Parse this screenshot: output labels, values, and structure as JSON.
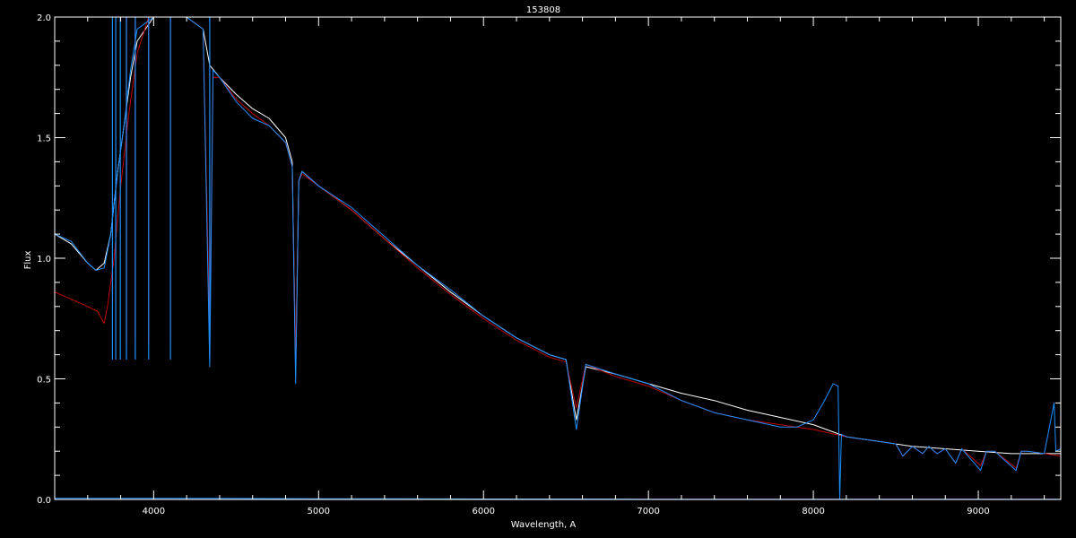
{
  "chart_data": {
    "type": "line",
    "title": "153808",
    "xlabel": "Wavelength, A",
    "ylabel": "Flux",
    "xlim": [
      3400,
      9500
    ],
    "ylim": [
      0.0,
      2.0
    ],
    "x_ticks": [
      4000,
      5000,
      6000,
      7000,
      8000,
      9000
    ],
    "x_tick_labels": [
      "4000",
      "5000",
      "6000",
      "7000",
      "8000",
      "9000"
    ],
    "y_ticks": [
      0.0,
      0.5,
      1.0,
      1.5,
      2.0
    ],
    "y_tick_labels": [
      "0.0",
      "0.5",
      "1.0",
      "1.5",
      "2.0"
    ],
    "background": "#000000",
    "series": [
      {
        "color": "#ffffff",
        "points": [
          [
            3400,
            1.1
          ],
          [
            3500,
            1.06
          ],
          [
            3600,
            0.98
          ],
          [
            3650,
            0.95
          ],
          [
            3700,
            0.98
          ],
          [
            3740,
            1.1
          ],
          [
            3780,
            1.35
          ],
          [
            3820,
            1.55
          ],
          [
            3860,
            1.75
          ],
          [
            3900,
            1.9
          ],
          [
            4000,
            2.2
          ],
          [
            4100,
            2.2
          ],
          [
            4200,
            2.1
          ],
          [
            4300,
            1.95
          ],
          [
            4340,
            1.8
          ],
          [
            4400,
            1.75
          ],
          [
            4500,
            1.68
          ],
          [
            4600,
            1.62
          ],
          [
            4700,
            1.58
          ],
          [
            4800,
            1.5
          ],
          [
            4840,
            1.4
          ],
          [
            4861,
            0.55
          ],
          [
            4880,
            1.32
          ],
          [
            4900,
            1.36
          ],
          [
            5000,
            1.3
          ],
          [
            5200,
            1.2
          ],
          [
            5400,
            1.08
          ],
          [
            5600,
            0.97
          ],
          [
            5800,
            0.86
          ],
          [
            6000,
            0.76
          ],
          [
            6200,
            0.67
          ],
          [
            6400,
            0.6
          ],
          [
            6500,
            0.58
          ],
          [
            6563,
            0.33
          ],
          [
            6620,
            0.55
          ],
          [
            6800,
            0.52
          ],
          [
            7000,
            0.48
          ],
          [
            7200,
            0.44
          ],
          [
            7400,
            0.41
          ],
          [
            7600,
            0.37
          ],
          [
            7800,
            0.34
          ],
          [
            8000,
            0.31
          ],
          [
            8200,
            0.26
          ],
          [
            8400,
            0.24
          ],
          [
            8600,
            0.22
          ],
          [
            8800,
            0.21
          ],
          [
            9000,
            0.2
          ],
          [
            9200,
            0.19
          ],
          [
            9400,
            0.19
          ],
          [
            9500,
            0.19
          ]
        ]
      },
      {
        "color": "#c00000",
        "points": [
          [
            3400,
            0.86
          ],
          [
            3500,
            0.83
          ],
          [
            3600,
            0.8
          ],
          [
            3660,
            0.78
          ],
          [
            3700,
            0.73
          ],
          [
            3720,
            0.8
          ],
          [
            3760,
            1.0
          ],
          [
            3800,
            1.3
          ],
          [
            3850,
            1.6
          ],
          [
            3900,
            1.85
          ],
          [
            3970,
            2.2
          ],
          [
            4100,
            2.2
          ],
          [
            4200,
            2.15
          ],
          [
            4300,
            1.95
          ],
          [
            4340,
            0.7
          ],
          [
            4360,
            1.75
          ],
          [
            4400,
            1.75
          ],
          [
            4500,
            1.66
          ],
          [
            4600,
            1.6
          ],
          [
            4700,
            1.55
          ],
          [
            4800,
            1.48
          ],
          [
            4840,
            1.38
          ],
          [
            4861,
            0.6
          ],
          [
            4880,
            1.32
          ],
          [
            4900,
            1.35
          ],
          [
            5000,
            1.3
          ],
          [
            5200,
            1.2
          ],
          [
            5400,
            1.08
          ],
          [
            5600,
            0.96
          ],
          [
            5800,
            0.85
          ],
          [
            6000,
            0.75
          ],
          [
            6200,
            0.66
          ],
          [
            6400,
            0.59
          ],
          [
            6500,
            0.57
          ],
          [
            6563,
            0.38
          ],
          [
            6620,
            0.56
          ],
          [
            6800,
            0.51
          ],
          [
            7000,
            0.47
          ],
          [
            7200,
            0.41
          ],
          [
            7400,
            0.36
          ],
          [
            7600,
            0.33
          ],
          [
            7800,
            0.31
          ],
          [
            8000,
            0.29
          ],
          [
            8200,
            0.26
          ],
          [
            8400,
            0.24
          ],
          [
            8500,
            0.23
          ],
          [
            8542,
            0.18
          ],
          [
            8600,
            0.22
          ],
          [
            8662,
            0.19
          ],
          [
            8700,
            0.22
          ],
          [
            8750,
            0.19
          ],
          [
            8800,
            0.21
          ],
          [
            8863,
            0.15
          ],
          [
            8900,
            0.21
          ],
          [
            9014,
            0.14
          ],
          [
            9050,
            0.2
          ],
          [
            9100,
            0.2
          ],
          [
            9229,
            0.13
          ],
          [
            9260,
            0.2
          ],
          [
            9300,
            0.2
          ],
          [
            9500,
            0.18
          ]
        ]
      },
      {
        "color": "#1e90ff",
        "points": [
          [
            3400,
            1.1
          ],
          [
            3500,
            1.07
          ],
          [
            3600,
            0.98
          ],
          [
            3650,
            0.95
          ],
          [
            3700,
            0.96
          ],
          [
            3740,
            1.1
          ],
          [
            3780,
            1.35
          ],
          [
            3820,
            1.55
          ],
          [
            3860,
            1.78
          ],
          [
            3900,
            1.95
          ],
          [
            4000,
            2.2
          ],
          [
            4100,
            2.2
          ],
          [
            4200,
            2.1
          ],
          [
            4300,
            1.95
          ],
          [
            4340,
            0.55
          ],
          [
            4360,
            1.78
          ],
          [
            4400,
            1.75
          ],
          [
            4500,
            1.65
          ],
          [
            4600,
            1.58
          ],
          [
            4700,
            1.55
          ],
          [
            4800,
            1.48
          ],
          [
            4840,
            1.38
          ],
          [
            4861,
            0.48
          ],
          [
            4880,
            1.32
          ],
          [
            4900,
            1.36
          ],
          [
            5000,
            1.3
          ],
          [
            5200,
            1.21
          ],
          [
            5400,
            1.09
          ],
          [
            5600,
            0.97
          ],
          [
            5800,
            0.87
          ],
          [
            6000,
            0.76
          ],
          [
            6200,
            0.67
          ],
          [
            6400,
            0.6
          ],
          [
            6500,
            0.58
          ],
          [
            6563,
            0.29
          ],
          [
            6620,
            0.56
          ],
          [
            6800,
            0.52
          ],
          [
            7000,
            0.48
          ],
          [
            7200,
            0.41
          ],
          [
            7400,
            0.36
          ],
          [
            7600,
            0.33
          ],
          [
            7800,
            0.3
          ],
          [
            7900,
            0.3
          ],
          [
            8000,
            0.33
          ],
          [
            8060,
            0.4
          ],
          [
            8120,
            0.48
          ],
          [
            8150,
            0.47
          ],
          [
            8160,
            0.0
          ],
          [
            8170,
            0.27
          ],
          [
            8200,
            0.26
          ],
          [
            8400,
            0.24
          ],
          [
            8500,
            0.23
          ],
          [
            8542,
            0.18
          ],
          [
            8600,
            0.22
          ],
          [
            8662,
            0.19
          ],
          [
            8700,
            0.22
          ],
          [
            8750,
            0.19
          ],
          [
            8800,
            0.21
          ],
          [
            8863,
            0.15
          ],
          [
            8900,
            0.21
          ],
          [
            9014,
            0.12
          ],
          [
            9050,
            0.2
          ],
          [
            9100,
            0.2
          ],
          [
            9229,
            0.12
          ],
          [
            9260,
            0.2
          ],
          [
            9300,
            0.2
          ],
          [
            9400,
            0.19
          ],
          [
            9460,
            0.4
          ],
          [
            9470,
            0.2
          ],
          [
            9500,
            0.21
          ]
        ]
      },
      {
        "color": "#1e90ff",
        "points": [
          [
            3400,
            0.005
          ],
          [
            3700,
            0.005
          ],
          [
            4000,
            0.005
          ],
          [
            4500,
            0.004
          ],
          [
            5000,
            0.003
          ],
          [
            5500,
            0.003
          ],
          [
            6000,
            0.002
          ],
          [
            6500,
            0.002
          ],
          [
            7000,
            0.001
          ],
          [
            7500,
            0.001
          ],
          [
            8000,
            0.001
          ],
          [
            8500,
            0.001
          ],
          [
            9000,
            0.001
          ],
          [
            9500,
            0.001
          ]
        ]
      }
    ],
    "absorption_lines_blue": [
      3750,
      3770,
      3798,
      3835,
      3889,
      3970,
      4102,
      4340
    ],
    "absorption_lines_red": [
      3835,
      3889,
      3970,
      4102
    ]
  }
}
